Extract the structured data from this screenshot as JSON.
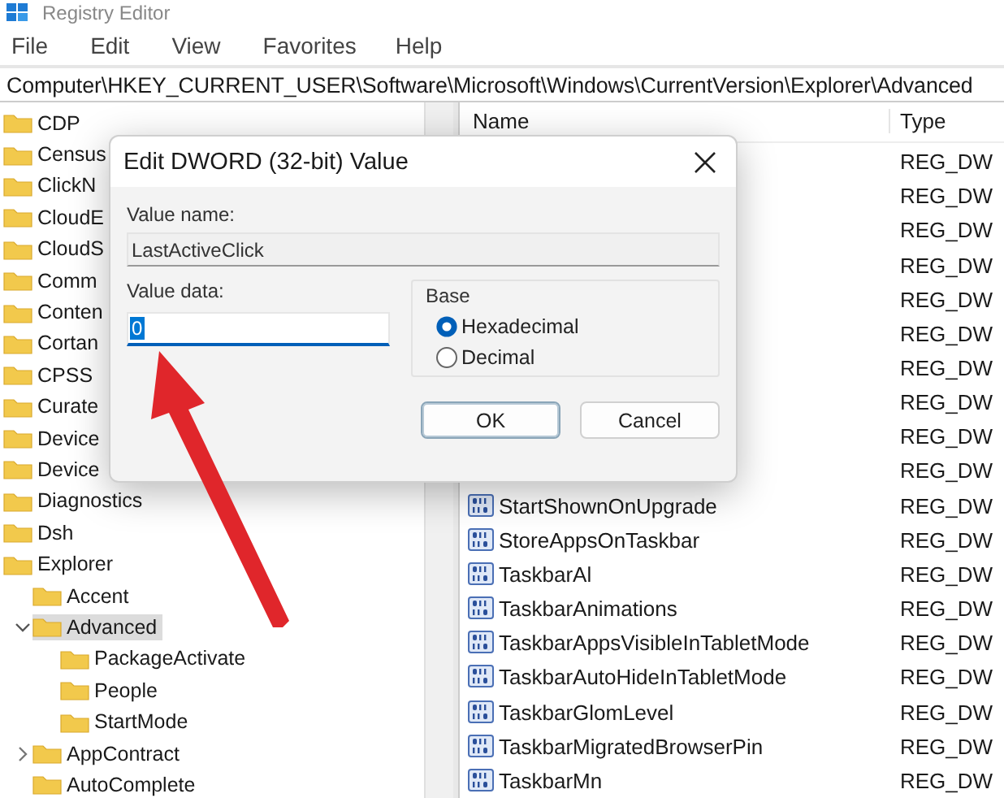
{
  "window": {
    "title": "Registry Editor"
  },
  "menu": [
    "File",
    "Edit",
    "View",
    "Favorites",
    "Help"
  ],
  "address": "Computer\\HKEY_CURRENT_USER\\Software\\Microsoft\\Windows\\CurrentVersion\\Explorer\\Advanced",
  "tree": [
    {
      "label": "CDP",
      "selected": false
    },
    {
      "label": "Census",
      "selected": false
    },
    {
      "label": "ClickN",
      "selected": false
    },
    {
      "label": "CloudE",
      "selected": false
    },
    {
      "label": "CloudS",
      "selected": false
    },
    {
      "label": "Comm",
      "selected": false
    },
    {
      "label": "Conten",
      "selected": false
    },
    {
      "label": "Cortan",
      "selected": false
    },
    {
      "label": "CPSS",
      "selected": false
    },
    {
      "label": "Curate",
      "selected": false
    },
    {
      "label": "Device",
      "selected": false
    },
    {
      "label": "Device",
      "selected": false
    },
    {
      "label": "Diagnostics",
      "selected": false
    },
    {
      "label": "Dsh",
      "selected": false
    },
    {
      "label": "Explorer",
      "selected": false,
      "children": [
        {
          "label": "Accent",
          "selected": false
        },
        {
          "label": "Advanced",
          "selected": true,
          "expanded": true,
          "children": [
            {
              "label": "PackageActivate",
              "selected": false
            },
            {
              "label": "People",
              "selected": false
            },
            {
              "label": "StartMode",
              "selected": false
            }
          ]
        },
        {
          "label": "AppContract",
          "selected": false,
          "expanded": false
        },
        {
          "label": "AutoComplete",
          "selected": false
        }
      ]
    }
  ],
  "values": {
    "columns": [
      "Name",
      "Type"
    ],
    "rows": [
      {
        "type": "REG_DW"
      },
      {
        "type": "REG_DW"
      },
      {
        "type": "REG_DW"
      },
      {
        "type": "REG_DW"
      },
      {
        "type": "REG_DW"
      },
      {
        "type": "REG_DW"
      },
      {
        "type": "REG_DW"
      },
      {
        "type": "REG_DW"
      },
      {
        "type": "REG_DW"
      },
      {
        "type": "REG_DW"
      },
      {
        "name": "StartShownOnUpgrade",
        "type": "REG_DW"
      },
      {
        "name": "StoreAppsOnTaskbar",
        "type": "REG_DW"
      },
      {
        "name": "TaskbarAl",
        "type": "REG_DW"
      },
      {
        "name": "TaskbarAnimations",
        "type": "REG_DW"
      },
      {
        "name": "TaskbarAppsVisibleInTabletMode",
        "type": "REG_DW"
      },
      {
        "name": "TaskbarAutoHideInTabletMode",
        "type": "REG_DW"
      },
      {
        "name": "TaskbarGlomLevel",
        "type": "REG_DW"
      },
      {
        "name": "TaskbarMigratedBrowserPin",
        "type": "REG_DW"
      },
      {
        "name": "TaskbarMn",
        "type": "REG_DW"
      }
    ]
  },
  "dialog": {
    "title": "Edit DWORD (32-bit) Value",
    "value_name_label": "Value name:",
    "value_name": "LastActiveClick",
    "value_data_label": "Value data:",
    "value_data": "0",
    "base": {
      "label": "Base",
      "options": [
        {
          "label": "Hexadecimal",
          "selected": true
        },
        {
          "label": "Decimal",
          "selected": false
        }
      ]
    },
    "buttons": [
      {
        "label": "OK",
        "default": true
      },
      {
        "label": "Cancel",
        "default": false
      }
    ]
  }
}
